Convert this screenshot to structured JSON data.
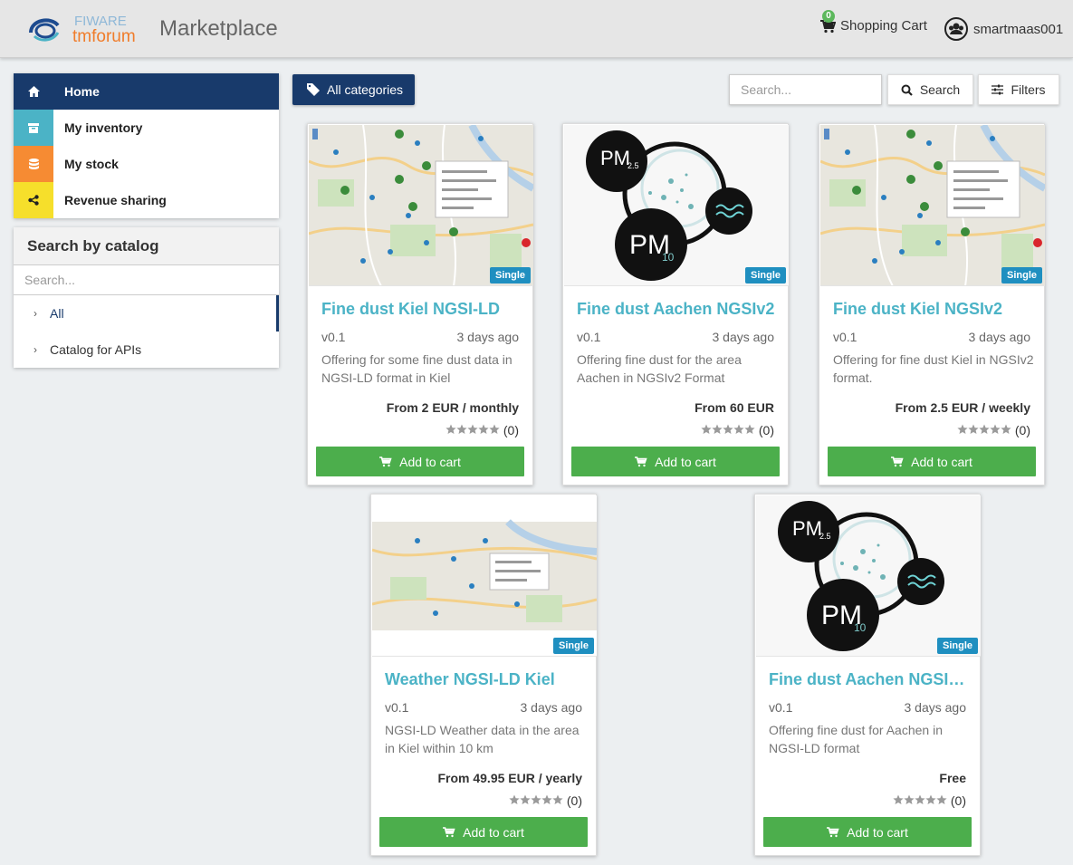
{
  "header": {
    "logo_top": "FIWARE",
    "logo_bottom": "tmforum",
    "title": "Marketplace",
    "cart_label": "Shopping Cart",
    "cart_count": "0",
    "username": "smartmaas001"
  },
  "nav": {
    "items": [
      {
        "label": "Home",
        "icon": "home-icon",
        "color": "#183a6b"
      },
      {
        "label": "My inventory",
        "icon": "archive-icon",
        "color": "#4bb3c6"
      },
      {
        "label": "My stock",
        "icon": "database-icon",
        "color": "#f68b33"
      },
      {
        "label": "Revenue sharing",
        "icon": "share-icon",
        "color": "#f6df2b"
      }
    ]
  },
  "catalog": {
    "title": "Search by catalog",
    "search_placeholder": "Search...",
    "items": [
      {
        "label": "All"
      },
      {
        "label": "Catalog for APIs"
      }
    ]
  },
  "toolbar": {
    "all_categories": "All categories",
    "search_placeholder": "Search...",
    "search_button": "Search",
    "filters_button": "Filters"
  },
  "offerings": [
    {
      "title": "Fine dust Kiel NGSI-LD",
      "version": "v0.1",
      "date": "3 days ago",
      "desc": "Offering for some fine dust data in NGSI-LD format in Kiel",
      "price": "From 2 EUR / monthly",
      "rating": "(0)",
      "badge": "Single",
      "button": "Add to cart",
      "image": "map"
    },
    {
      "title": "Fine dust Aachen NGSIv2",
      "version": "v0.1",
      "date": "3 days ago",
      "desc": "Offering fine dust for the area Aachen in NGSIv2 Format",
      "price": "From 60 EUR",
      "rating": "(0)",
      "badge": "Single",
      "button": "Add to cart",
      "image": "pm"
    },
    {
      "title": "Fine dust Kiel NGSIv2",
      "version": "v0.1",
      "date": "3 days ago",
      "desc": "Offering for fine dust Kiel in NGSIv2 format.",
      "price": "From 2.5 EUR / weekly",
      "rating": "(0)",
      "badge": "Single",
      "button": "Add to cart",
      "image": "map"
    },
    {
      "title": "Weather NGSI-LD Kiel",
      "version": "v0.1",
      "date": "3 days ago",
      "desc": "NGSI-LD Weather data in the area in Kiel within 10 km",
      "price": "From 49.95 EUR / yearly",
      "rating": "(0)",
      "badge": "Single",
      "button": "Add to cart",
      "image": "map-wide"
    },
    {
      "title": "Fine dust Aachen NGSI-LD",
      "version": "v0.1",
      "date": "3 days ago",
      "desc": "Offering fine dust for Aachen in NGSI-LD format",
      "price": "Free",
      "rating": "(0)",
      "badge": "Single",
      "button": "Add to cart",
      "image": "pm"
    }
  ],
  "pm_labels": {
    "pm25": "PM",
    "pm25_sub": "2.5",
    "pm10": "PM",
    "pm10_sub": "10"
  }
}
